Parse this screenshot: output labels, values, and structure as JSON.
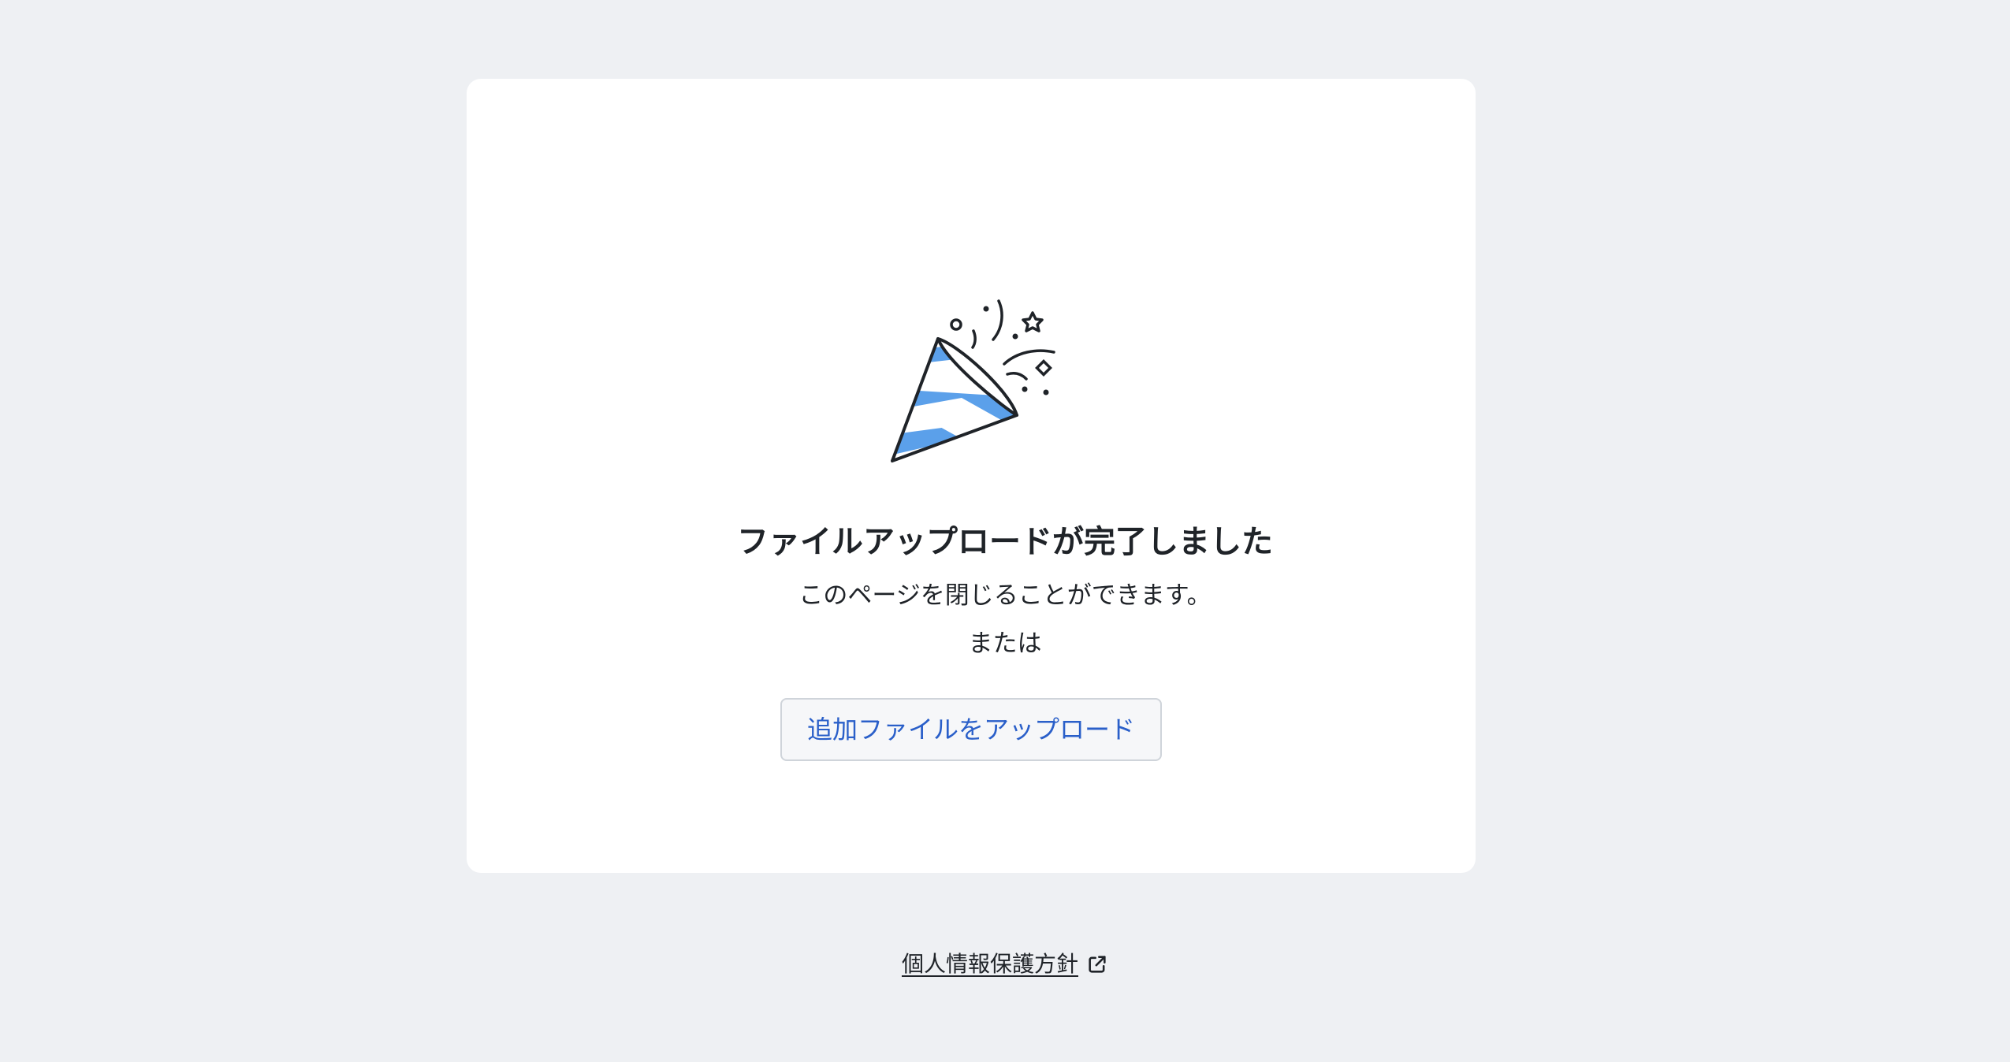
{
  "main": {
    "title": "ファイルアップロードが完了しました",
    "subtitle": "このページを閉じることができます。",
    "or_text": "または",
    "upload_more_label": "追加ファイルをアップロード",
    "illustration_icon": "party-popper-icon"
  },
  "footer": {
    "privacy_link_label": "個人情報保護方針",
    "external_link_icon": "external-link-icon"
  },
  "colors": {
    "background": "#eef0f3",
    "card": "#ffffff",
    "accent_blue": "#5ba0ea",
    "link_blue": "#2a5fc9"
  }
}
